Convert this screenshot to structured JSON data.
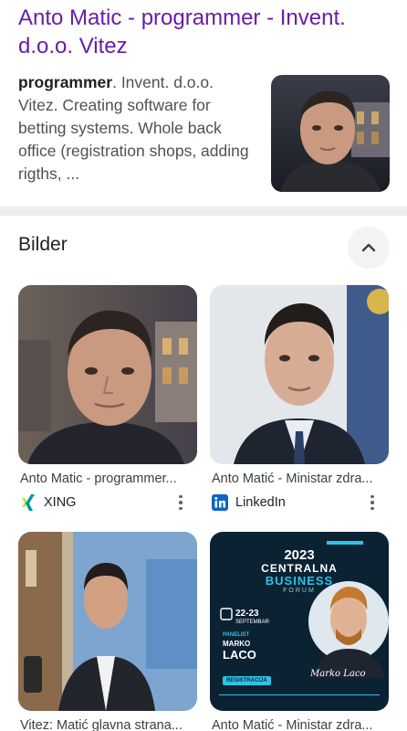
{
  "result": {
    "title": "Anto Matic - programmer - Invent. d.o.o. Vitez",
    "snippet_bold": "programmer",
    "snippet_rest": ". Invent. d.o.o. Vitez. Creating software for betting systems. Whole back office (registration shops, adding rigths, ..."
  },
  "images_section": {
    "title": "Bilder",
    "collapse_icon": "chevron-up-icon",
    "cards": [
      {
        "caption": "Anto Matic - programmer...",
        "source": "XING",
        "source_icon": "xing-icon"
      },
      {
        "caption": "Anto Matić - Ministar zdra...",
        "source": "LinkedIn",
        "source_icon": "linkedin-icon"
      },
      {
        "caption": "Vitez: Matić glavna strana..."
      },
      {
        "caption": "Anto Matić - Ministar zdra..."
      }
    ],
    "poster": {
      "year": "2023",
      "line1": "CENTRALNA",
      "line2": "BUSINESS",
      "line3": "FORUM",
      "dates": "22-23",
      "month": "SEPTEMBAR",
      "panelist_label": "PANELIST",
      "panelist_first": "MARKO",
      "panelist_last": "LACO",
      "registration": "REGISTRACIJA",
      "signature": "Marko Laco"
    }
  },
  "colors": {
    "visited_link": "#681da8",
    "snippet_text": "#4d5156",
    "divider": "#ebedf0",
    "linkedin": "#0a66c2",
    "xing_green": "#b7df4b",
    "xing_teal": "#0698a0",
    "poster_bg": "#0b2233",
    "poster_accent": "#2fc2e8"
  }
}
